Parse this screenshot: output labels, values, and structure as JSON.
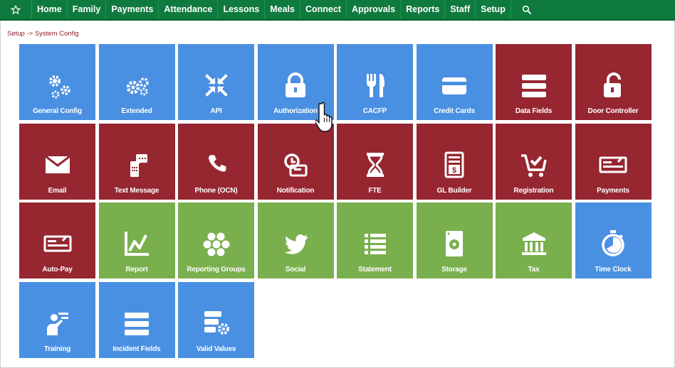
{
  "nav": {
    "items": [
      "Home",
      "Family",
      "Payments",
      "Attendance",
      "Lessons",
      "Meals",
      "Connect",
      "Approvals",
      "Reports",
      "Staff",
      "Setup"
    ],
    "star_icon": "star-icon",
    "search_icon": "search-icon"
  },
  "breadcrumb": "Setup -> System Config",
  "colors": {
    "blue": "#4a90e2",
    "red": "#962630",
    "green": "#7aaf4e",
    "nav": "#0f7a3e"
  },
  "tiles": [
    {
      "label": "General Config",
      "icon": "gears-icon",
      "color": "blue"
    },
    {
      "label": "Extended",
      "icon": "cogs-icon",
      "color": "blue"
    },
    {
      "label": "API",
      "icon": "compress-arrows-icon",
      "color": "blue"
    },
    {
      "label": "Authorization",
      "icon": "lock-icon",
      "color": "blue"
    },
    {
      "label": "CACFP",
      "icon": "utensils-icon",
      "color": "blue"
    },
    {
      "label": "Credit Cards",
      "icon": "credit-card-icon",
      "color": "blue"
    },
    {
      "label": "Data Fields",
      "icon": "bars-icon",
      "color": "red"
    },
    {
      "label": "Door Controller",
      "icon": "unlock-icon",
      "color": "red"
    },
    {
      "label": "Email",
      "icon": "envelope-icon",
      "color": "red"
    },
    {
      "label": "Text Message",
      "icon": "mobile-message-icon",
      "color": "red"
    },
    {
      "label": "Phone (OCN)",
      "icon": "phone-icon",
      "color": "red"
    },
    {
      "label": "Notification",
      "icon": "notification-icon",
      "color": "red"
    },
    {
      "label": "FTE",
      "icon": "hourglass-icon",
      "color": "red"
    },
    {
      "label": "GL Builder",
      "icon": "ledger-icon",
      "color": "red"
    },
    {
      "label": "Registration",
      "icon": "cart-check-icon",
      "color": "red"
    },
    {
      "label": "Payments",
      "icon": "check-payment-icon",
      "color": "red"
    },
    {
      "label": "Auto-Pay",
      "icon": "check-payment-icon",
      "color": "red"
    },
    {
      "label": "Report",
      "icon": "line-chart-icon",
      "color": "green"
    },
    {
      "label": "Reporting Groups",
      "icon": "hexagons-icon",
      "color": "green"
    },
    {
      "label": "Social",
      "icon": "twitter-icon",
      "color": "green"
    },
    {
      "label": "Statement",
      "icon": "list-icon",
      "color": "green"
    },
    {
      "label": "Storage",
      "icon": "hard-drive-icon",
      "color": "green"
    },
    {
      "label": "Tax",
      "icon": "bank-icon",
      "color": "green"
    },
    {
      "label": "Time Clock",
      "icon": "stopwatch-icon",
      "color": "blue"
    },
    {
      "label": "Training",
      "icon": "training-icon",
      "color": "blue"
    },
    {
      "label": "Incident Fields",
      "icon": "bars-icon",
      "color": "blue"
    },
    {
      "label": "Valid Values",
      "icon": "server-gear-icon",
      "color": "blue"
    }
  ]
}
